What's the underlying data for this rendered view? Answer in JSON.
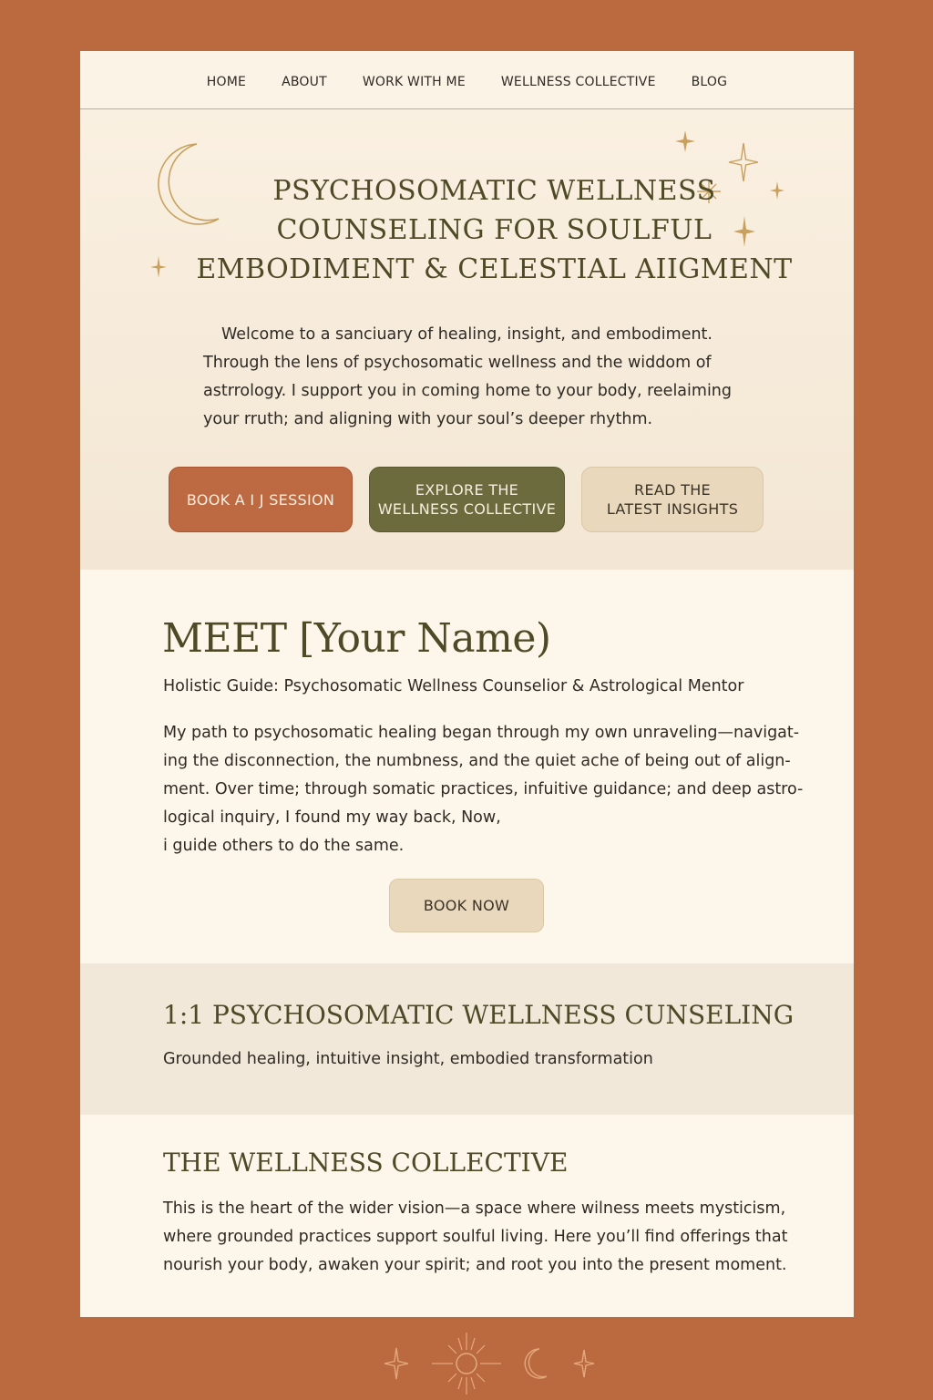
{
  "nav": {
    "items": [
      "HOME",
      "ABOUT",
      "WORK WITH ME",
      "WELLNESS COLLECTIVE",
      "BLOG"
    ]
  },
  "hero": {
    "title_lines": [
      "PSYCHOSOMATIC WELLNESS",
      "COUNSELING FOR SOULFUL",
      "EMBODIMENT & CELESTIAL AIIGMENT"
    ],
    "intro": "Welcome to a sanciuary of healing, insight, and embodiment. Through the lens of psychosomatic wellness and the widdom of astrrology. I support you in coming home to your body, reelaiming your rruth; and aligning with your soul’s deeper rhythm.",
    "buttons": {
      "primary": "BOOK A I J SESSION",
      "secondary_lines": [
        "EXPLORE THE",
        "WELLNESS COLLECTIVE"
      ],
      "tertiary_lines": [
        "READ THE",
        "LATEST INSIGHTS"
      ]
    }
  },
  "meet": {
    "heading": "MEET [Your Name)",
    "role": "Holistic Guide: Psychosomatic Wellness Counselior & Astrological Mentor",
    "bio_lines": [
      "My path to psychosomatic healing began through my own unraveling—navigat-",
      "ing the disconnection, the numbness, and the quiet ache of being out of align-",
      "ment. Over time; through somatic practices, infuitive guidance; and deep astro-",
      "logical inquiry, I found my way back, Now,",
      "i guide others to do the same."
    ],
    "book_now": "BOOK NOW"
  },
  "counseling": {
    "heading": "1:1 PSYCHOSOMATIC WELLNESS CUNSELING",
    "subtitle": "Grounded healing, intuitive insight, embodied transformation"
  },
  "collective": {
    "heading": "THE WELLNESS COLLECTIVE",
    "body_lines": [
      "This is the heart of the wider vision—a space where wilness meets mysticism,",
      "where grounded practices support soulful living. Here you’ll find offerings that",
      "nourish your body, awaken your spirit; and root you into the present moment."
    ]
  },
  "colors": {
    "background": "#bb6a40",
    "page": "#fdf6ea",
    "accent_terracotta": "#bd6a42",
    "accent_olive": "#6c6b3d",
    "accent_sand": "#e9d8bc",
    "heading": "#4e4a26",
    "gold": "#c9a15f"
  },
  "icons": [
    "crescent-moon-icon",
    "sparkle-star-icon",
    "sun-icon"
  ]
}
